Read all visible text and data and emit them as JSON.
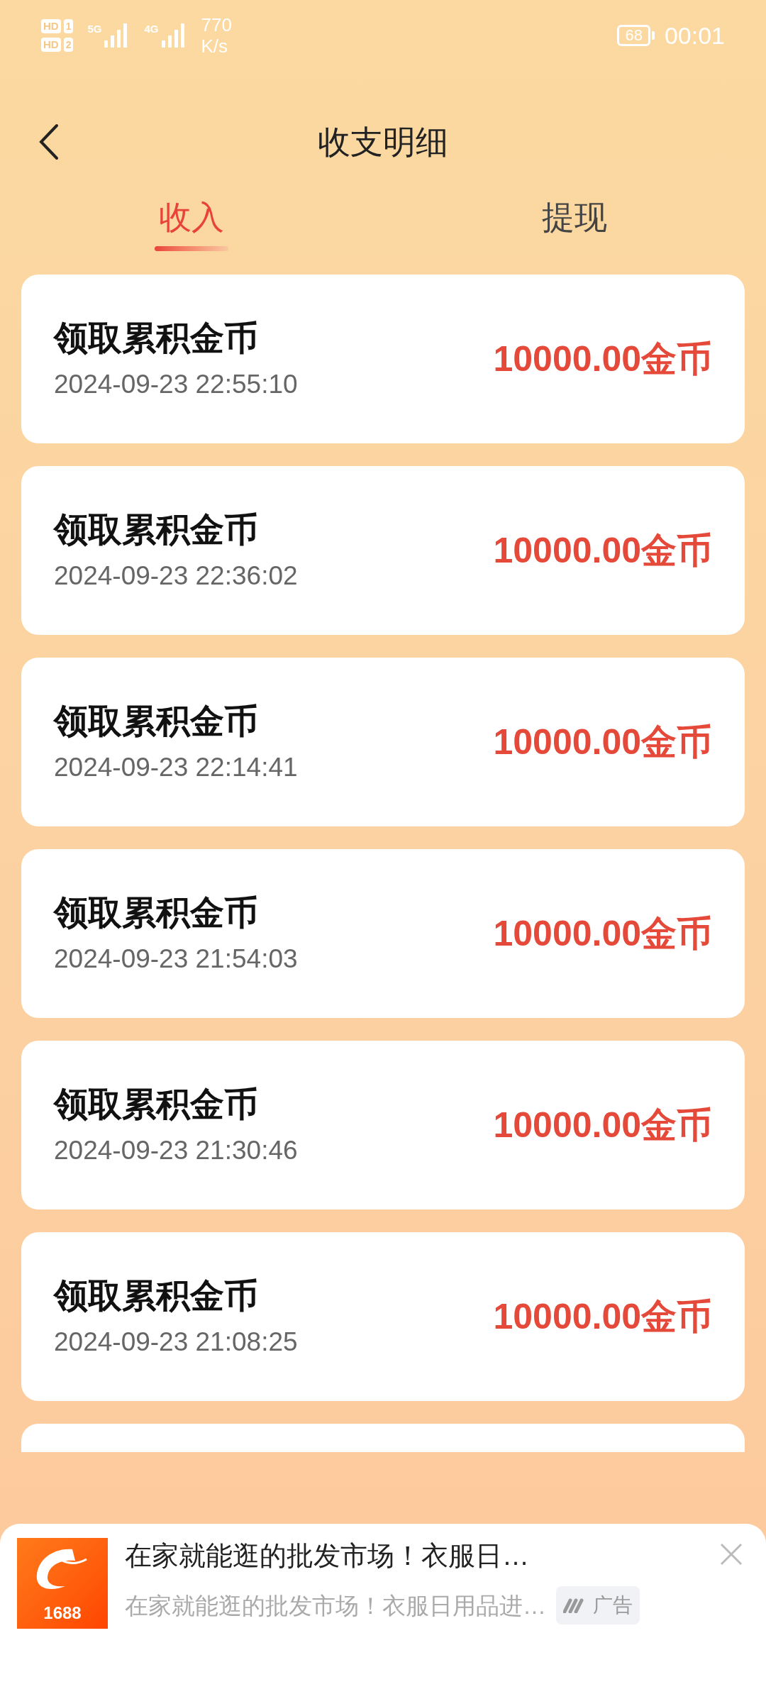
{
  "status_bar": {
    "sims": [
      {
        "badge": "HD",
        "slot": "1",
        "network": "5G"
      },
      {
        "badge": "HD",
        "slot": "2",
        "network": "4G"
      }
    ],
    "speed_value": "770",
    "speed_unit": "K/s",
    "battery": "68",
    "time": "00:01"
  },
  "header": {
    "title": "收支明细"
  },
  "tabs": [
    {
      "label": "收入",
      "selected": true
    },
    {
      "label": "提现",
      "selected": false
    }
  ],
  "records": [
    {
      "title": "领取累积金币",
      "time": "2024-09-23 22:55:10",
      "amount": "10000.00金币"
    },
    {
      "title": "领取累积金币",
      "time": "2024-09-23 22:36:02",
      "amount": "10000.00金币"
    },
    {
      "title": "领取累积金币",
      "time": "2024-09-23 22:14:41",
      "amount": "10000.00金币"
    },
    {
      "title": "领取累积金币",
      "time": "2024-09-23 21:54:03",
      "amount": "10000.00金币"
    },
    {
      "title": "领取累积金币",
      "time": "2024-09-23 21:30:46",
      "amount": "10000.00金币"
    },
    {
      "title": "领取累积金币",
      "time": "2024-09-23 21:08:25",
      "amount": "10000.00金币"
    }
  ],
  "ad": {
    "logo_text": "1688",
    "title": "在家就能逛的批发市场！衣服日…",
    "description": "在家就能逛的批发市场！衣服日用品进…",
    "tag": "广告"
  }
}
